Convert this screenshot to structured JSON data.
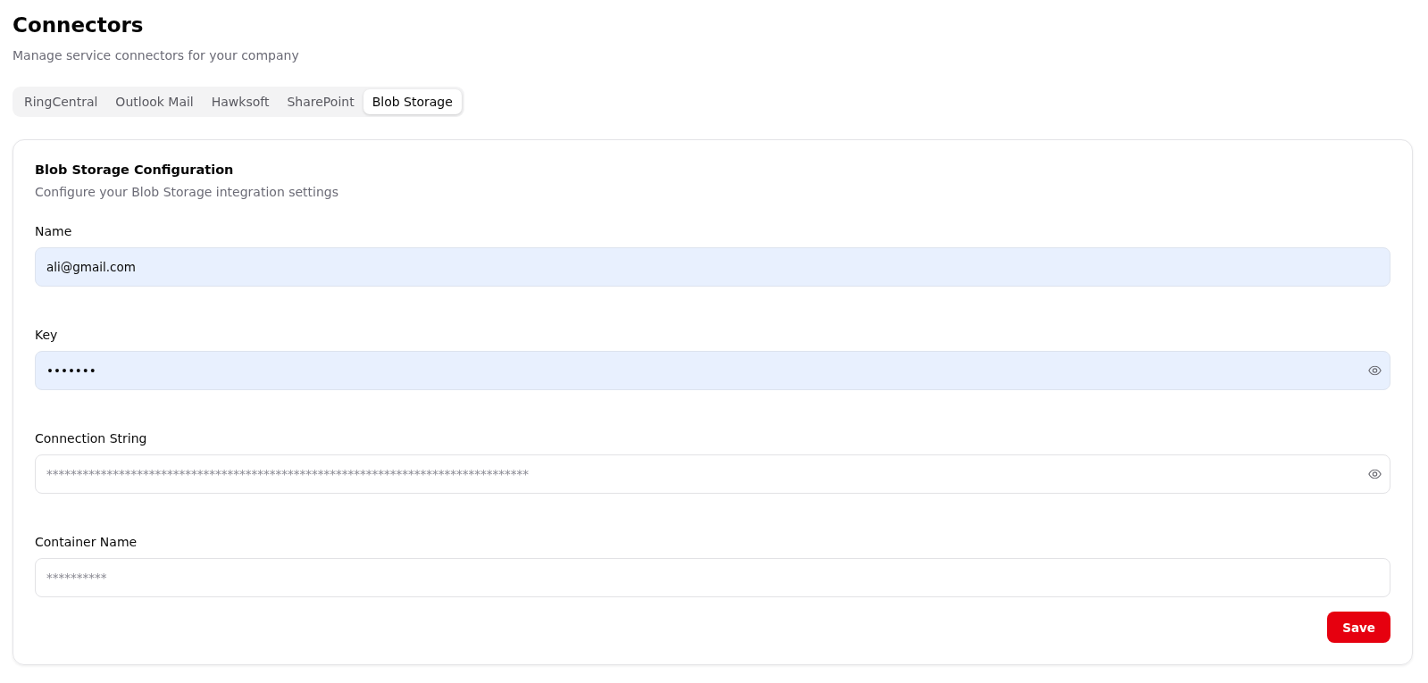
{
  "page": {
    "title": "Connectors",
    "subtitle": "Manage service connectors for your company"
  },
  "tabs": [
    {
      "label": "RingCentral",
      "selected": false
    },
    {
      "label": "Outlook Mail",
      "selected": false
    },
    {
      "label": "Hawksoft",
      "selected": false
    },
    {
      "label": "SharePoint",
      "selected": false
    },
    {
      "label": "Blob Storage",
      "selected": true
    }
  ],
  "card": {
    "title": "Blob Storage Configuration",
    "description": "Configure your Blob Storage integration settings",
    "fields": [
      {
        "label": "Name",
        "kind": "text",
        "value": "ali@gmail.com",
        "autofilled": true
      },
      {
        "label": "Key",
        "kind": "secret",
        "value": "•••••••",
        "autofilled": true
      },
      {
        "label": "Connection String",
        "kind": "secret",
        "placeholder": "********************************************************************************",
        "autofilled": false
      },
      {
        "label": "Container Name",
        "kind": "text",
        "placeholder": "**********",
        "autofilled": false
      }
    ],
    "save_button": "Save"
  }
}
